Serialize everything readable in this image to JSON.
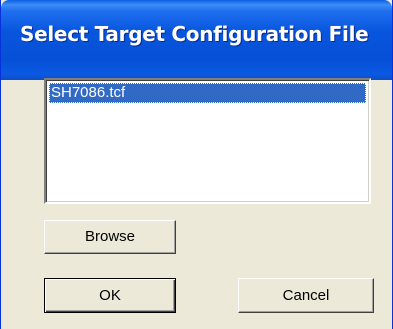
{
  "window": {
    "title": "Select Target Configuration File"
  },
  "file_list": {
    "items": [
      "SH7086.tcf"
    ],
    "selected_index": 0
  },
  "buttons": {
    "browse_label": "Browse",
    "ok_label": "OK",
    "cancel_label": "Cancel"
  },
  "colors": {
    "titlebar": "#0855dd",
    "selection": "#316ac5",
    "face": "#ece9d8"
  }
}
